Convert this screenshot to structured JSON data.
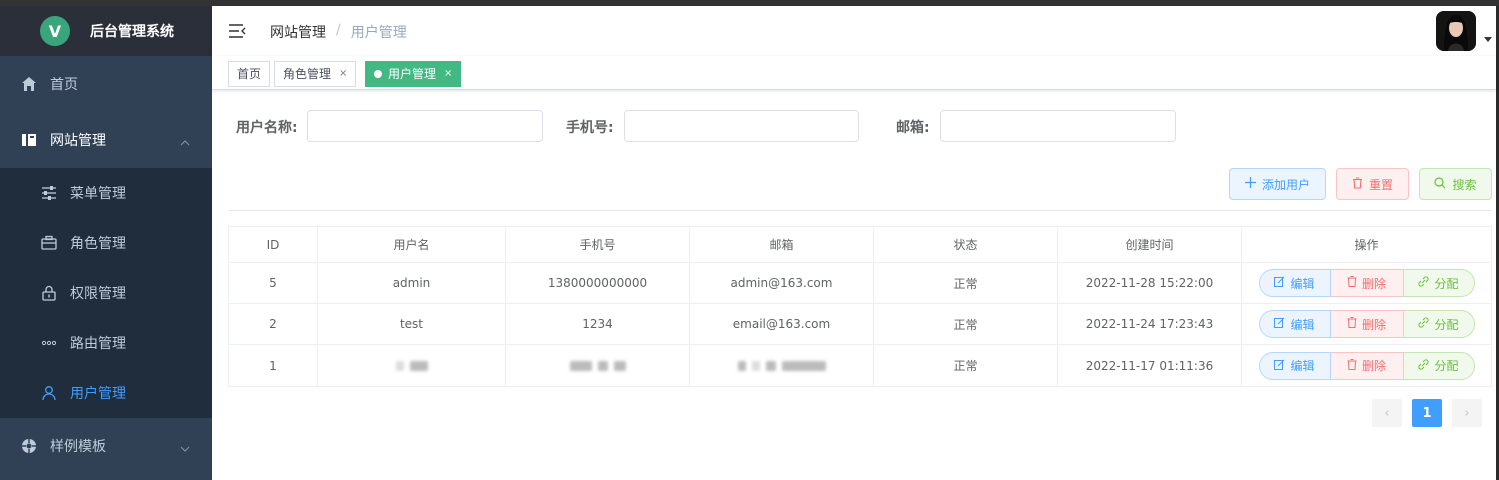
{
  "app": {
    "title": "后台管理系统",
    "logo_letter": "V"
  },
  "sidebar": {
    "items": [
      {
        "label": "首页",
        "icon": "home-icon"
      },
      {
        "label": "网站管理",
        "icon": "book-icon",
        "expanded": true
      },
      {
        "label": "样例模板",
        "icon": "template-icon",
        "expanded": false
      }
    ],
    "subitems": [
      {
        "label": "菜单管理",
        "icon": "sliders-icon"
      },
      {
        "label": "角色管理",
        "icon": "briefcase-icon"
      },
      {
        "label": "权限管理",
        "icon": "lock-icon"
      },
      {
        "label": "路由管理",
        "icon": "more-dots-icon"
      },
      {
        "label": "用户管理",
        "icon": "user-icon",
        "active": true
      }
    ]
  },
  "breadcrumb": {
    "parent": "网站管理",
    "separator": "/",
    "current": "用户管理"
  },
  "tags": [
    {
      "label": "首页"
    },
    {
      "label": "角色管理",
      "close": "×"
    },
    {
      "label": "用户管理",
      "close": "×",
      "active": true
    }
  ],
  "filters": {
    "username_label": "用户名称:",
    "phone_label": "手机号:",
    "email_label": "邮箱:"
  },
  "actions": {
    "add": "添加用户",
    "reset": "重置",
    "search": "搜索"
  },
  "table": {
    "headers": [
      "ID",
      "用户名",
      "手机号",
      "邮箱",
      "状态",
      "创建时间",
      "操作"
    ],
    "rows": [
      {
        "id": "5",
        "name": "admin",
        "phone": "1380000000000",
        "email": "admin@163.com",
        "status": "正常",
        "created": "2022-11-28 15:22:00"
      },
      {
        "id": "2",
        "name": "test",
        "phone": "1234",
        "email": "email@163.com",
        "status": "正常",
        "created": "2022-11-24 17:23:43"
      },
      {
        "id": "1",
        "name": "",
        "phone": "",
        "email": "",
        "status": "正常",
        "created": "2022-11-17 01:11:36"
      }
    ],
    "op_labels": {
      "edit": "编辑",
      "delete": "删除",
      "assign": "分配"
    }
  },
  "pagination": {
    "current": "1",
    "prev": "‹",
    "next": "›"
  },
  "colors": {
    "primary": "#409eff",
    "danger": "#f56c6c",
    "success": "#67c23a",
    "tag_active": "#42b983",
    "sidebar_bg": "#304156"
  }
}
